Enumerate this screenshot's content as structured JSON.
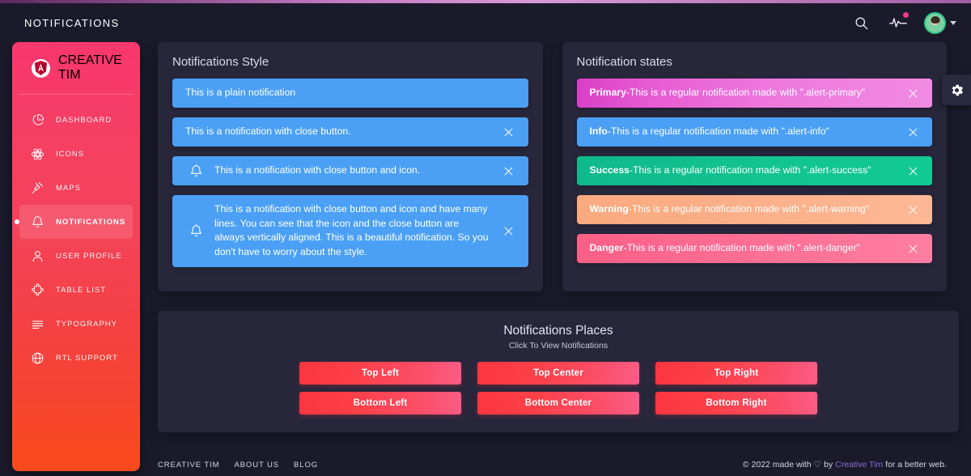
{
  "navbar": {
    "title": "NOTIFICATIONS",
    "search_icon": "search-icon",
    "activity_icon": "activity-pulse-icon",
    "avatar_icon": "user-avatar"
  },
  "sidebar": {
    "brand": "CREATIVE TIM",
    "logo_icon": "angular-logo-icon",
    "items": [
      {
        "label": "DASHBOARD",
        "icon": "pie-chart-icon",
        "active": false
      },
      {
        "label": "ICONS",
        "icon": "atom-icon",
        "active": false
      },
      {
        "label": "MAPS",
        "icon": "pin-icon",
        "active": false
      },
      {
        "label": "NOTIFICATIONS",
        "icon": "bell-icon",
        "active": true
      },
      {
        "label": "USER PROFILE",
        "icon": "user-icon",
        "active": false
      },
      {
        "label": "TABLE LIST",
        "icon": "puzzle-icon",
        "active": false
      },
      {
        "label": "TYPOGRAPHY",
        "icon": "text-lines-icon",
        "active": false
      },
      {
        "label": "RTL SUPPORT",
        "icon": "globe-icon",
        "active": false
      }
    ]
  },
  "styles_panel": {
    "title": "Notifications Style",
    "alerts": [
      {
        "text": "This is a plain notification",
        "close": false,
        "icon": false,
        "color": "bg-info"
      },
      {
        "text": "This is a notification with close button.",
        "close": true,
        "icon": false,
        "color": "bg-info"
      },
      {
        "text": "This is a notification with close button and icon.",
        "close": true,
        "icon": true,
        "color": "bg-info"
      },
      {
        "text": "This is a notification with close button and icon and have many lines. You can see that the icon and the close button are always vertically aligned. This is a beautiful notification. So you don't have to worry about the style.",
        "close": true,
        "icon": true,
        "color": "bg-info"
      }
    ]
  },
  "states_panel": {
    "title": "Notification states",
    "alerts": [
      {
        "strong": "Primary",
        "dash": " - ",
        "text": "This is a regular notification made with \".alert-primary\"",
        "color": "bg-primary",
        "close": true
      },
      {
        "strong": "Info",
        "dash": " - ",
        "text": "This is a regular notification made with \".alert-info\"",
        "color": "bg-info",
        "close": true
      },
      {
        "strong": "Success",
        "dash": " - ",
        "text": "This is a regular notification made with \".alert-success\"",
        "color": "bg-success",
        "close": true
      },
      {
        "strong": "Warning",
        "dash": " - ",
        "text": "This is a regular notification made with \".alert-warning\"",
        "color": "bg-warning",
        "close": true
      },
      {
        "strong": "Danger",
        "dash": " - ",
        "text": "This is a regular notification made with \".alert-danger\"",
        "color": "bg-danger",
        "close": true
      }
    ]
  },
  "places_panel": {
    "title": "Notifications Places",
    "subtitle": "Click To View Notifications",
    "buttons": [
      {
        "label": "Top Left"
      },
      {
        "label": "Top Center"
      },
      {
        "label": "Top Right"
      },
      {
        "label": "Bottom Left"
      },
      {
        "label": "Bottom Center"
      },
      {
        "label": "Bottom Right"
      }
    ]
  },
  "footer": {
    "links": [
      {
        "label": "CREATIVE TIM"
      },
      {
        "label": "ABOUT US"
      },
      {
        "label": "BLOG"
      }
    ],
    "copyright_prefix": "© 2022 made with",
    "heart": "♡",
    "by": "by",
    "brand_link": "Creative Tim",
    "copyright_suffix": "for a better web."
  },
  "settings": {
    "gear_icon": "gear-icon"
  },
  "colors": {
    "page_bg": "#1b1a2b",
    "card_bg": "#27263b",
    "sidebar_from": "#f8376e",
    "sidebar_to": "#f84a1c",
    "info": "#4ba0f5",
    "primary": "#e75bd2",
    "success": "#12c38e",
    "warning": "#fbb08a",
    "danger": "#fd6f95",
    "accent_link": "#8e6ad6"
  }
}
